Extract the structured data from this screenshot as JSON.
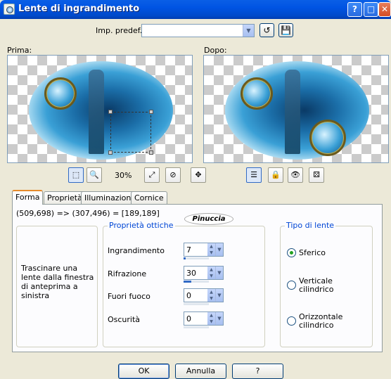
{
  "window": {
    "title": "Lente di ingrandimento"
  },
  "preset": {
    "label": "Imp. predef.:",
    "value": ""
  },
  "previews": {
    "before_label": "Prima:",
    "after_label": "Dopo:"
  },
  "toolbar": {
    "zoom": "30%"
  },
  "tabs": [
    {
      "label": "Forma"
    },
    {
      "label": "Proprietà"
    },
    {
      "label": "Illuminazione"
    },
    {
      "label": "Cornice"
    }
  ],
  "coords": "(509,698) => (307,496) = [189,189]",
  "signature": "Pinuccia",
  "info_text": "Trascinare una lente dalla finestra di anteprima a sinistra",
  "optics": {
    "title": "Proprietà ottiche",
    "fields": [
      {
        "label": "Ingrandimento",
        "value": "7",
        "level": 0.07
      },
      {
        "label": "Rifrazione",
        "value": "30",
        "level": 0.3
      },
      {
        "label": "Fuori fuoco",
        "value": "0",
        "level": 0
      },
      {
        "label": "Oscurità",
        "value": "0",
        "level": 0
      }
    ]
  },
  "lens_type": {
    "title": "Tipo di lente",
    "options": [
      {
        "label": "Sferico",
        "selected": true
      },
      {
        "label": "Verticale cilindrico",
        "selected": false
      },
      {
        "label": "Orizzontale cilindrico",
        "selected": false
      }
    ]
  },
  "buttons": {
    "ok": "OK",
    "cancel": "Annulla",
    "help": "?"
  }
}
